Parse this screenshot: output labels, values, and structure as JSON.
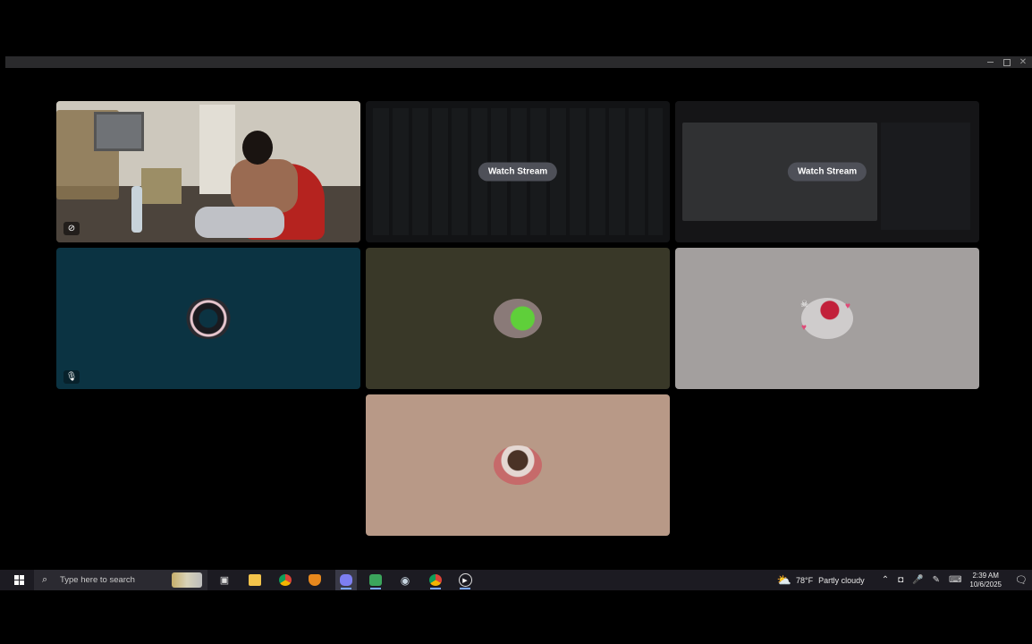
{
  "window": {
    "minimize_icon": "minimize-icon",
    "maximize_icon": "maximize-icon",
    "close_icon": "close-icon"
  },
  "tiles": [
    {
      "type": "camera",
      "icon": "camera-off-icon"
    },
    {
      "type": "stream",
      "button_label": "Watch Stream"
    },
    {
      "type": "stream",
      "button_label": "Watch Stream"
    },
    {
      "type": "avatar",
      "icon": "mic-muted-icon",
      "bg": "#0b3342"
    },
    {
      "type": "avatar",
      "bg": "#393828"
    },
    {
      "type": "avatar",
      "bg": "#a39f9e"
    },
    {
      "type": "avatar",
      "bg": "#b89987"
    }
  ],
  "taskbar": {
    "search_placeholder": "Type here to search",
    "apps": [
      "task-view",
      "file-explorer",
      "chrome",
      "brave",
      "discord",
      "discord-variant",
      "steam",
      "chrome-alt",
      "media-player"
    ],
    "weather": {
      "temp": "78°F",
      "condition": "Partly cloudy"
    },
    "clock": {
      "time": "2:39 AM",
      "date": "10/6/2025"
    }
  }
}
